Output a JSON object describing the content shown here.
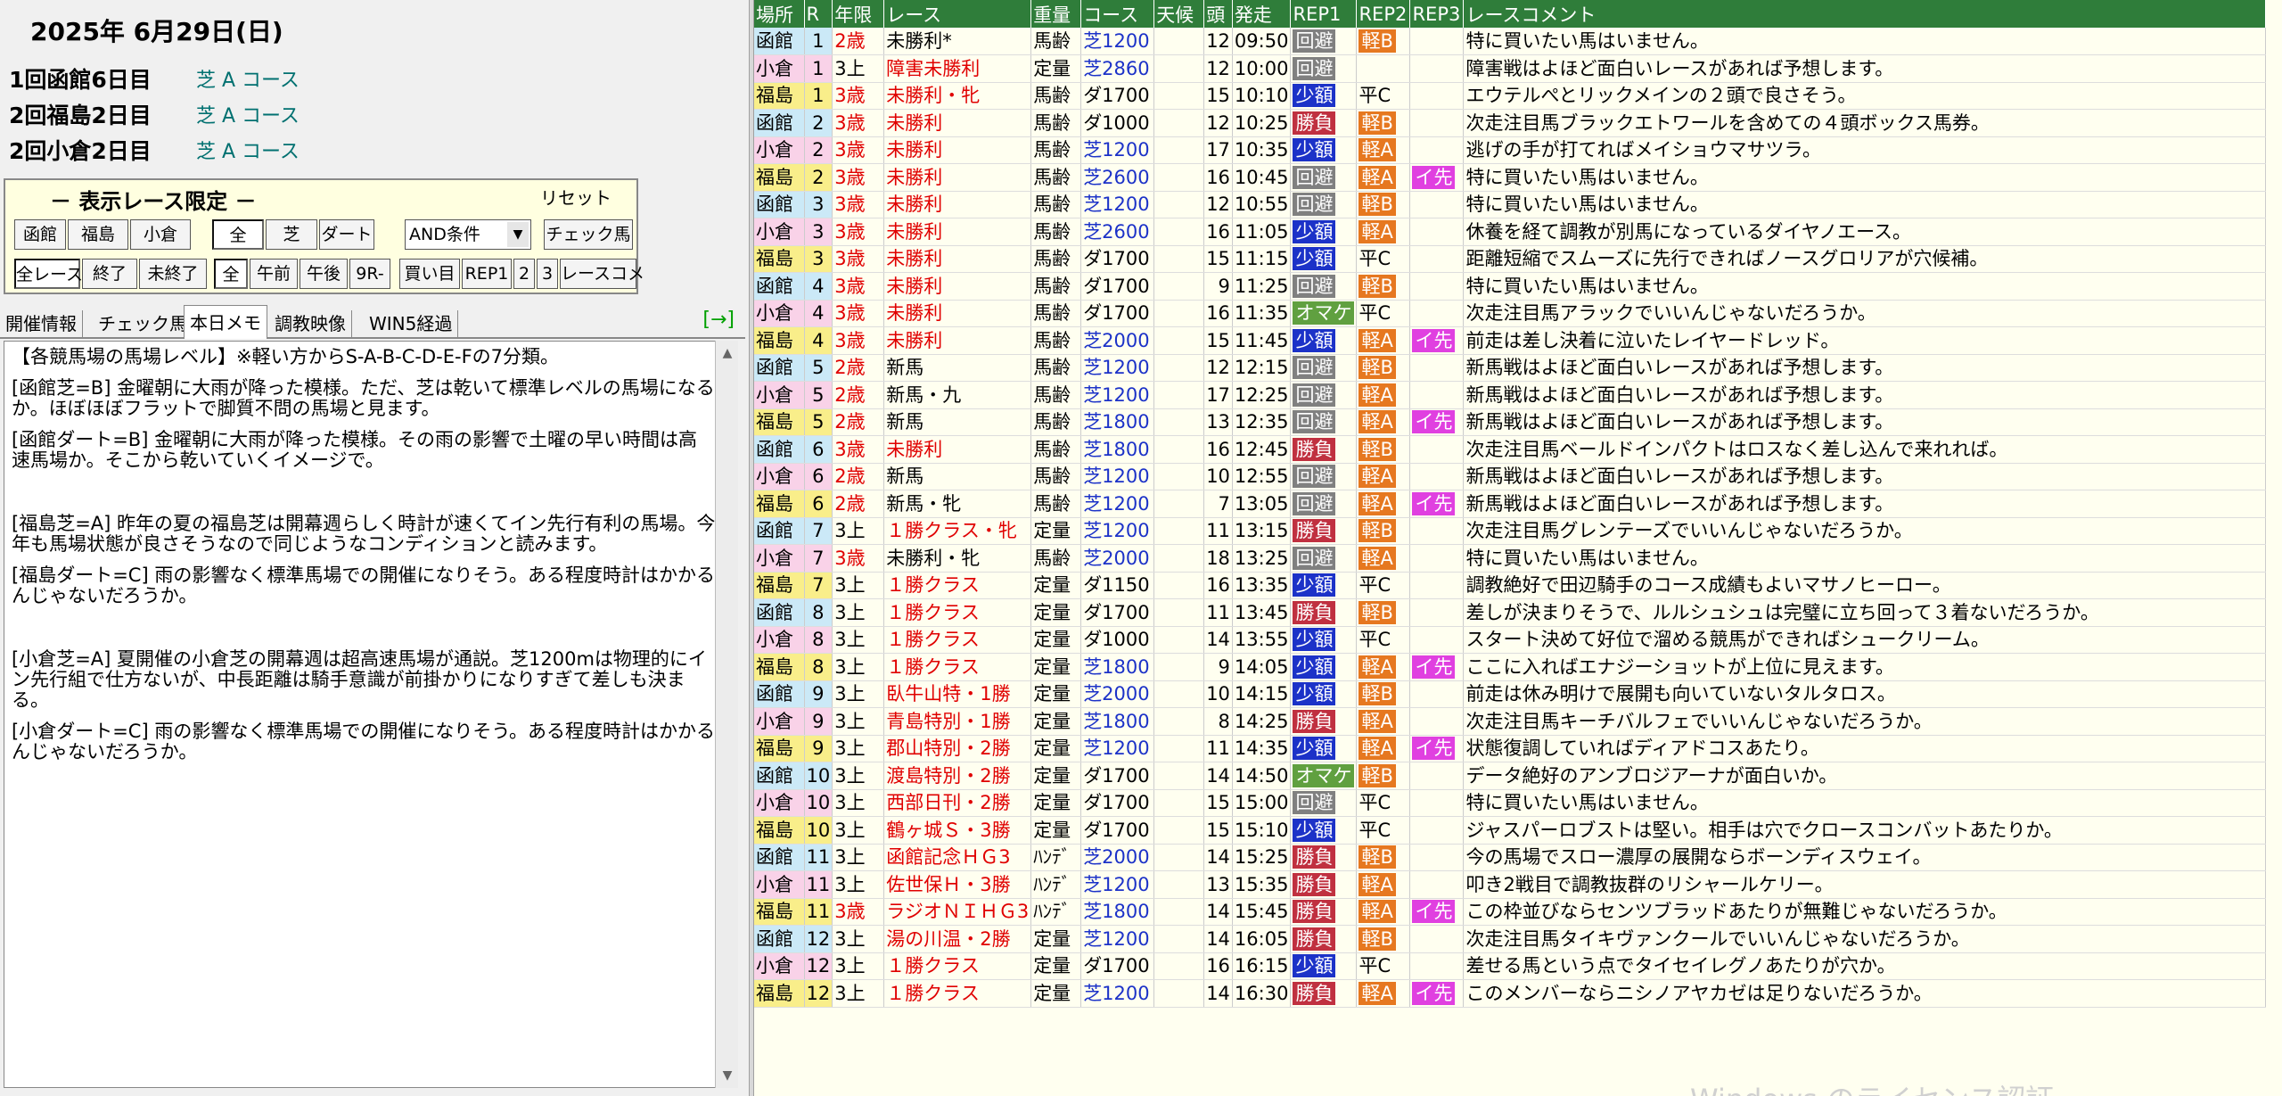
{
  "left": {
    "date": "2025年 6月29日(日)",
    "meetings": [
      {
        "name": "1回函館6日目",
        "track": "芝 A コース"
      },
      {
        "name": "2回福島2日目",
        "track": "芝 A コース"
      },
      {
        "name": "2回小倉2日目",
        "track": "芝 A コース"
      }
    ],
    "filter": {
      "title": "－ 表示レース限定 －",
      "reset": "リセット",
      "row1": [
        "函館",
        "福島",
        "小倉",
        "全",
        "芝",
        "ダート"
      ],
      "condition": "AND条件",
      "check_horse": "チェック馬",
      "row2": [
        "全レース",
        "終了",
        "未終了",
        "全",
        "午前",
        "午後",
        "9R-",
        "買い目",
        "REP1",
        "2",
        "3",
        "レースコメ"
      ]
    },
    "tabs": [
      "開催情報",
      "チェック馬",
      "本日メモ",
      "調教映像",
      "WIN5経過"
    ],
    "tab_arrow": "[→]",
    "memo": [
      "【各競馬場の馬場レベル】※軽い方からS-A-B-C-D-E-Fの7分類。",
      "[函館芝=B] 金曜朝に大雨が降った模様。ただ、芝は乾いて標準レベルの馬場になるか。ほぼほぼフラットで脚質不問の馬場と見ます。",
      "[函館ダート=B] 金曜朝に大雨が降った模様。その雨の影響で土曜の早い時間は高速馬場か。そこから乾いていくイメージで。",
      "[福島芝=A] 昨年の夏の福島芝は開幕週らしく時計が速くてイン先行有利の馬場。今年も馬場状態が良さそうなので同じようなコンディションと読みます。",
      "[福島ダート=C] 雨の影響なく標準馬場での開催になりそう。ある程度時計はかかるんじゃないだろうか。",
      "[小倉芝=A] 夏開催の小倉芝の開幕週は超高速馬場が通説。芝1200mは物理的にイン先行組で仕方ないが、中長距離は騎手意識が前掛かりになりすぎて差しも決まる。",
      "[小倉ダート=C] 雨の影響なく標準馬場での開催になりそう。ある程度時計はかかるんじゃないだろうか。"
    ]
  },
  "table": {
    "headers": [
      "場所",
      "R",
      "年限",
      "レース",
      "重量",
      "コース",
      "天候",
      "頭",
      "発走",
      "REP1",
      "REP2",
      "REP3",
      "レースコメント"
    ],
    "rows": [
      {
        "place": "函館",
        "r": "1",
        "age": "2歳",
        "race": "未勝利*",
        "weight": "馬齢",
        "course": "芝1200",
        "heads": "12",
        "time": "09:50",
        "rep1": "回避",
        "rep2": "軽B",
        "rep3": "",
        "comment": "特に買いたい馬はいません。"
      },
      {
        "place": "小倉",
        "r": "1",
        "age": "3上",
        "race": "障害未勝利",
        "weight": "定量",
        "course": "芝2860",
        "heads": "12",
        "time": "10:00",
        "rep1": "回避",
        "rep2": "",
        "rep3": "",
        "comment": "障害戦はよほど面白いレースがあれば予想します。"
      },
      {
        "place": "福島",
        "r": "1",
        "age": "3歳",
        "race": "未勝利・牝",
        "weight": "馬齢",
        "course": "ダ1700",
        "heads": "15",
        "time": "10:10",
        "rep1": "少額",
        "rep2": "平C",
        "rep3": "",
        "comment": "エウテルぺとリックメインの２頭で良さそう。"
      },
      {
        "place": "函館",
        "r": "2",
        "age": "3歳",
        "race": "未勝利",
        "weight": "馬齢",
        "course": "ダ1000",
        "heads": "12",
        "time": "10:25",
        "rep1": "勝負",
        "rep2": "軽B",
        "rep3": "",
        "comment": "次走注目馬ブラックエトワールを含めての４頭ボックス馬券。"
      },
      {
        "place": "小倉",
        "r": "2",
        "age": "3歳",
        "race": "未勝利",
        "weight": "馬齢",
        "course": "芝1200",
        "heads": "17",
        "time": "10:35",
        "rep1": "少額",
        "rep2": "軽A",
        "rep3": "",
        "comment": "逃げの手が打てればメイショウマサツラ。"
      },
      {
        "place": "福島",
        "r": "2",
        "age": "3歳",
        "race": "未勝利",
        "weight": "馬齢",
        "course": "芝2600",
        "heads": "16",
        "time": "10:45",
        "rep1": "回避",
        "rep2": "軽A",
        "rep3": "イ先",
        "comment": "特に買いたい馬はいません。"
      },
      {
        "place": "函館",
        "r": "3",
        "age": "3歳",
        "race": "未勝利",
        "weight": "馬齢",
        "course": "芝1200",
        "heads": "12",
        "time": "10:55",
        "rep1": "回避",
        "rep2": "軽B",
        "rep3": "",
        "comment": "特に買いたい馬はいません。"
      },
      {
        "place": "小倉",
        "r": "3",
        "age": "3歳",
        "race": "未勝利",
        "weight": "馬齢",
        "course": "芝2600",
        "heads": "16",
        "time": "11:05",
        "rep1": "少額",
        "rep2": "軽A",
        "rep3": "",
        "comment": "休養を経て調教が別馬になっているダイヤノエース。"
      },
      {
        "place": "福島",
        "r": "3",
        "age": "3歳",
        "race": "未勝利",
        "weight": "馬齢",
        "course": "ダ1700",
        "heads": "15",
        "time": "11:15",
        "rep1": "少額",
        "rep2": "平C",
        "rep3": "",
        "comment": "距離短縮でスムーズに先行できればノースグロリアが穴候補。"
      },
      {
        "place": "函館",
        "r": "4",
        "age": "3歳",
        "race": "未勝利",
        "weight": "馬齢",
        "course": "ダ1700",
        "heads": "9",
        "time": "11:25",
        "rep1": "回避",
        "rep2": "軽B",
        "rep3": "",
        "comment": "特に買いたい馬はいません。"
      },
      {
        "place": "小倉",
        "r": "4",
        "age": "3歳",
        "race": "未勝利",
        "weight": "馬齢",
        "course": "ダ1700",
        "heads": "16",
        "time": "11:35",
        "rep1": "オマケ",
        "rep2": "平C",
        "rep3": "",
        "comment": "次走注目馬アラックでいいんじゃないだろうか。"
      },
      {
        "place": "福島",
        "r": "4",
        "age": "3歳",
        "race": "未勝利",
        "weight": "馬齢",
        "course": "芝2000",
        "heads": "15",
        "time": "11:45",
        "rep1": "少額",
        "rep2": "軽A",
        "rep3": "イ先",
        "comment": "前走は差し決着に泣いたレイヤードレッド。"
      },
      {
        "place": "函館",
        "r": "5",
        "age": "2歳",
        "race": "新馬",
        "weight": "馬齢",
        "course": "芝1200",
        "heads": "12",
        "time": "12:15",
        "rep1": "回避",
        "rep2": "軽B",
        "rep3": "",
        "comment": "新馬戦はよほど面白いレースがあれば予想します。"
      },
      {
        "place": "小倉",
        "r": "5",
        "age": "2歳",
        "race": "新馬・九",
        "weight": "馬齢",
        "course": "芝1200",
        "heads": "17",
        "time": "12:25",
        "rep1": "回避",
        "rep2": "軽A",
        "rep3": "",
        "comment": "新馬戦はよほど面白いレースがあれば予想します。"
      },
      {
        "place": "福島",
        "r": "5",
        "age": "2歳",
        "race": "新馬",
        "weight": "馬齢",
        "course": "芝1800",
        "heads": "13",
        "time": "12:35",
        "rep1": "回避",
        "rep2": "軽A",
        "rep3": "イ先",
        "comment": "新馬戦はよほど面白いレースがあれば予想します。"
      },
      {
        "place": "函館",
        "r": "6",
        "age": "3歳",
        "race": "未勝利",
        "weight": "馬齢",
        "course": "芝1800",
        "heads": "16",
        "time": "12:45",
        "rep1": "勝負",
        "rep2": "軽B",
        "rep3": "",
        "comment": "次走注目馬ベールドインパクトはロスなく差し込んで来れれば。"
      },
      {
        "place": "小倉",
        "r": "6",
        "age": "2歳",
        "race": "新馬",
        "weight": "馬齢",
        "course": "芝1200",
        "heads": "10",
        "time": "12:55",
        "rep1": "回避",
        "rep2": "軽A",
        "rep3": "",
        "comment": "新馬戦はよほど面白いレースがあれば予想します。"
      },
      {
        "place": "福島",
        "r": "6",
        "age": "2歳",
        "race": "新馬・牝",
        "weight": "馬齢",
        "course": "芝1200",
        "heads": "7",
        "time": "13:05",
        "rep1": "回避",
        "rep2": "軽A",
        "rep3": "イ先",
        "comment": "新馬戦はよほど面白いレースがあれば予想します。"
      },
      {
        "place": "函館",
        "r": "7",
        "age": "3上",
        "race": "１勝クラス・牝",
        "weight": "定量",
        "course": "芝1200",
        "heads": "11",
        "time": "13:15",
        "rep1": "勝負",
        "rep2": "軽B",
        "rep3": "",
        "comment": "次走注目馬グレンテーズでいいんじゃないだろうか。"
      },
      {
        "place": "小倉",
        "r": "7",
        "age": "3歳",
        "race": "未勝利・牝",
        "weight": "馬齢",
        "course": "芝2000",
        "heads": "18",
        "time": "13:25",
        "rep1": "回避",
        "rep2": "軽A",
        "rep3": "",
        "comment": "特に買いたい馬はいません。"
      },
      {
        "place": "福島",
        "r": "7",
        "age": "3上",
        "race": "１勝クラス",
        "weight": "定量",
        "course": "ダ1150",
        "heads": "16",
        "time": "13:35",
        "rep1": "少額",
        "rep2": "平C",
        "rep3": "",
        "comment": "調教絶好で田辺騎手のコース成績もよいマサノヒーロー。"
      },
      {
        "place": "函館",
        "r": "8",
        "age": "3上",
        "race": "１勝クラス",
        "weight": "定量",
        "course": "ダ1700",
        "heads": "11",
        "time": "13:45",
        "rep1": "勝負",
        "rep2": "軽B",
        "rep3": "",
        "comment": "差しが決まりそうで、ルルシュシュは完璧に立ち回って３着ないだろうか。"
      },
      {
        "place": "小倉",
        "r": "8",
        "age": "3上",
        "race": "１勝クラス",
        "weight": "定量",
        "course": "ダ1000",
        "heads": "14",
        "time": "13:55",
        "rep1": "少額",
        "rep2": "平C",
        "rep3": "",
        "comment": "スタート決めて好位で溜める競馬ができればシュークリーム。"
      },
      {
        "place": "福島",
        "r": "8",
        "age": "3上",
        "race": "１勝クラス",
        "weight": "定量",
        "course": "芝1800",
        "heads": "9",
        "time": "14:05",
        "rep1": "少額",
        "rep2": "軽A",
        "rep3": "イ先",
        "comment": "ここに入ればエナジーショットが上位に見えます。"
      },
      {
        "place": "函館",
        "r": "9",
        "age": "3上",
        "race": "臥牛山特・1勝",
        "weight": "定量",
        "course": "芝2000",
        "heads": "10",
        "time": "14:15",
        "rep1": "少額",
        "rep2": "軽B",
        "rep3": "",
        "comment": "前走は休み明けで展開も向いていないタルタロス。"
      },
      {
        "place": "小倉",
        "r": "9",
        "age": "3上",
        "race": "青島特別・1勝",
        "weight": "定量",
        "course": "芝1800",
        "heads": "8",
        "time": "14:25",
        "rep1": "勝負",
        "rep2": "軽A",
        "rep3": "",
        "comment": "次走注目馬キーチバルフェでいいんじゃないだろうか。"
      },
      {
        "place": "福島",
        "r": "9",
        "age": "3上",
        "race": "郡山特別・2勝",
        "weight": "定量",
        "course": "芝1200",
        "heads": "11",
        "time": "14:35",
        "rep1": "少額",
        "rep2": "軽A",
        "rep3": "イ先",
        "comment": "状態復調していればディアドコスあたり。"
      },
      {
        "place": "函館",
        "r": "10",
        "age": "3上",
        "race": "渡島特別・2勝",
        "weight": "定量",
        "course": "ダ1700",
        "heads": "14",
        "time": "14:50",
        "rep1": "オマケ",
        "rep2": "軽B",
        "rep3": "",
        "comment": "データ絶好のアンブロジアーナが面白いか。"
      },
      {
        "place": "小倉",
        "r": "10",
        "age": "3上",
        "race": "西部日刊・2勝",
        "weight": "定量",
        "course": "ダ1700",
        "heads": "15",
        "time": "15:00",
        "rep1": "回避",
        "rep2": "平C",
        "rep3": "",
        "comment": "特に買いたい馬はいません。"
      },
      {
        "place": "福島",
        "r": "10",
        "age": "3上",
        "race": "鶴ヶ城Ｓ・3勝",
        "weight": "定量",
        "course": "ダ1700",
        "heads": "15",
        "time": "15:10",
        "rep1": "少額",
        "rep2": "平C",
        "rep3": "",
        "comment": "ジャスパーロブストは堅い。相手は穴でクロースコンバットあたりか。"
      },
      {
        "place": "函館",
        "r": "11",
        "age": "3上",
        "race": "函館記念ＨＧ3",
        "weight": "ﾊﾝﾃﾞ",
        "course": "芝2000",
        "heads": "14",
        "time": "15:25",
        "rep1": "勝負",
        "rep2": "軽B",
        "rep3": "",
        "comment": "今の馬場でスロー濃厚の展開ならボーンディスウェイ。"
      },
      {
        "place": "小倉",
        "r": "11",
        "age": "3上",
        "race": "佐世保Ｈ・3勝",
        "weight": "ﾊﾝﾃﾞ",
        "course": "芝1200",
        "heads": "13",
        "time": "15:35",
        "rep1": "勝負",
        "rep2": "軽A",
        "rep3": "",
        "comment": "叩き2戦目で調教抜群のリシャールケリー。"
      },
      {
        "place": "福島",
        "r": "11",
        "age": "3歳",
        "race": "ラジオＮＩＨＧ3",
        "weight": "ﾊﾝﾃﾞ",
        "course": "芝1800",
        "heads": "14",
        "time": "15:45",
        "rep1": "勝負",
        "rep2": "軽A",
        "rep3": "イ先",
        "comment": "この枠並びならセンツブラッドあたりが無難じゃないだろうか。"
      },
      {
        "place": "函館",
        "r": "12",
        "age": "3上",
        "race": "湯の川温・2勝",
        "weight": "定量",
        "course": "芝1200",
        "heads": "14",
        "time": "16:05",
        "rep1": "勝負",
        "rep2": "軽B",
        "rep3": "",
        "comment": "次走注目馬タイキヴァンクールでいいんじゃないだろうか。"
      },
      {
        "place": "小倉",
        "r": "12",
        "age": "3上",
        "race": "１勝クラス",
        "weight": "定量",
        "course": "ダ1700",
        "heads": "16",
        "time": "16:15",
        "rep1": "少額",
        "rep2": "平C",
        "rep3": "",
        "comment": "差せる馬という点でタイセイレグノあたりが穴か。"
      },
      {
        "place": "福島",
        "r": "12",
        "age": "3上",
        "race": "１勝クラス",
        "weight": "定量",
        "course": "芝1200",
        "heads": "14",
        "time": "16:30",
        "rep1": "勝負",
        "rep2": "軽A",
        "rep3": "イ先",
        "comment": "このメンバーならニシノアヤカゼは足りないだろうか。"
      }
    ]
  },
  "watermark": "Windows のライセンス認証"
}
